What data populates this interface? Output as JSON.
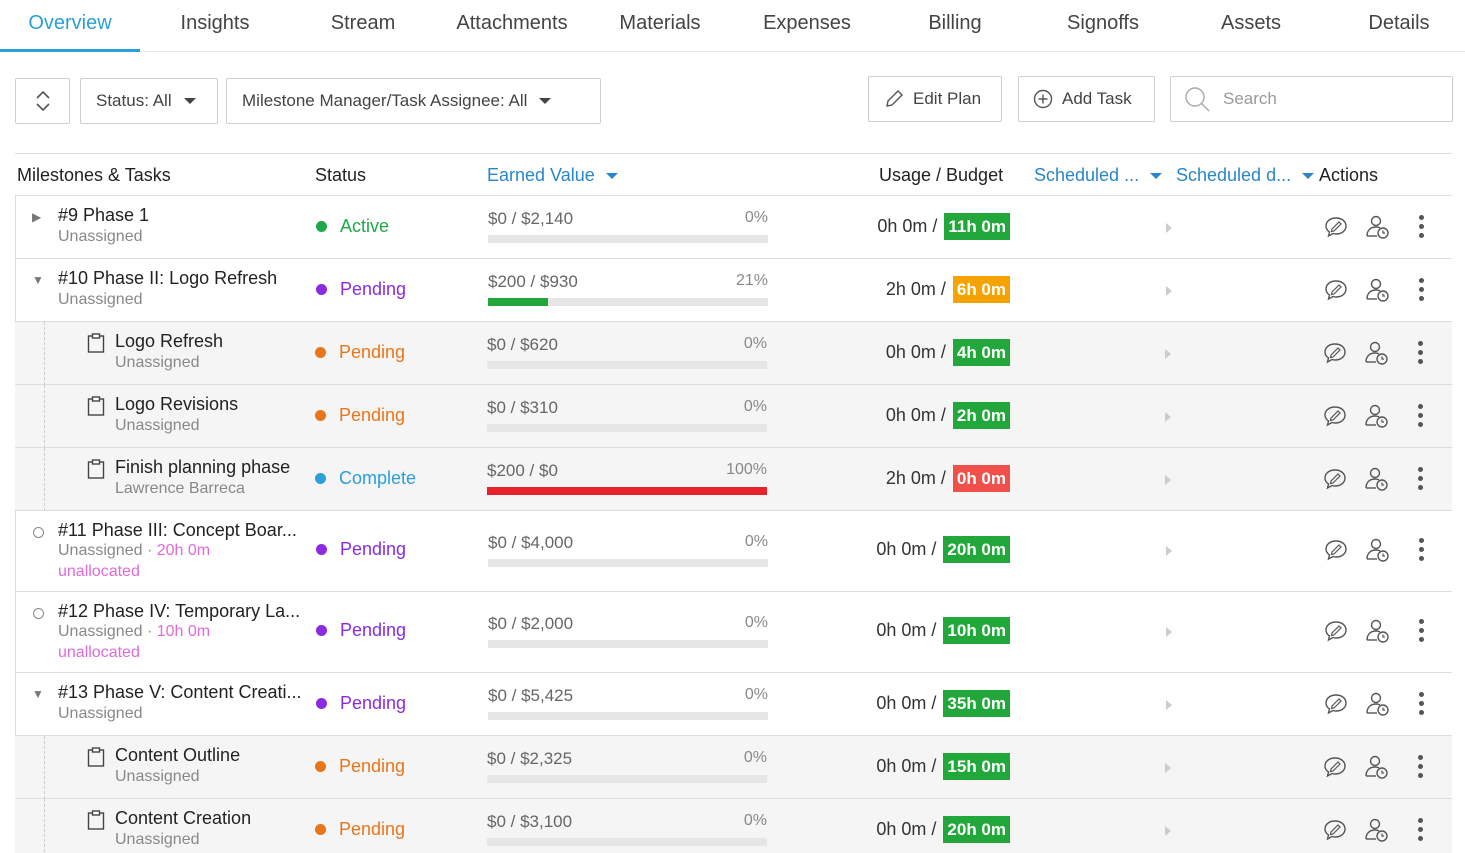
{
  "tabs": [
    "Overview",
    "Insights",
    "Stream",
    "Attachments",
    "Materials",
    "Expenses",
    "Billing",
    "Signoffs",
    "Assets",
    "Details"
  ],
  "toolbar": {
    "status_filter": "Status: All",
    "assignee_filter": "Milestone Manager/Task Assignee: All",
    "edit_plan": "Edit Plan",
    "add_task": "Add Task",
    "search_placeholder": "Search"
  },
  "table": {
    "headers": {
      "name": "Milestones & Tasks",
      "status": "Status",
      "earned_value": "Earned Value",
      "usage_budget": "Usage / Budget",
      "scheduled_start": "Scheduled ...",
      "scheduled_due": "Scheduled d...",
      "actions": "Actions"
    },
    "rows": [
      {
        "kind": "milestone",
        "toggle": "▶",
        "name": "#9 Phase 1",
        "assignee": "Unassigned",
        "status": "Active",
        "status_color": "#1fa84a",
        "ev": "$0 / $2,140",
        "pct": "0%",
        "fill": 0,
        "fill_color": "#22a83a",
        "usage": "0h 0m /",
        "budget": "11h 0m",
        "budget_color": "#22a83a"
      },
      {
        "kind": "milestone",
        "toggle": "▼",
        "name": "#10 Phase II: Logo Refresh",
        "assignee": "Unassigned",
        "status": "Pending",
        "status_color": "#8a2be2",
        "ev": "$200 / $930",
        "pct": "21%",
        "fill": 0.215,
        "fill_color": "#22a83a",
        "usage": "2h 0m /",
        "budget": "6h 0m",
        "budget_color": "#f5a300"
      },
      {
        "kind": "task",
        "name": "Logo Refresh",
        "assignee": "Unassigned",
        "status": "Pending",
        "status_color": "#e8751a",
        "ev": "$0 / $620",
        "pct": "0%",
        "fill": 0,
        "fill_color": "#22a83a",
        "usage": "0h 0m /",
        "budget": "4h 0m",
        "budget_color": "#22a83a"
      },
      {
        "kind": "task",
        "name": "Logo Revisions",
        "assignee": "Unassigned",
        "status": "Pending",
        "status_color": "#e8751a",
        "ev": "$0 / $310",
        "pct": "0%",
        "fill": 0,
        "fill_color": "#22a83a",
        "usage": "0h 0m /",
        "budget": "2h 0m",
        "budget_color": "#22a83a"
      },
      {
        "kind": "task",
        "name": "Finish planning phase",
        "assignee": "Lawrence Barreca",
        "status": "Complete",
        "status_color": "#2a9fd8",
        "ev": "$200 / $0",
        "pct": "100%",
        "fill": 1,
        "fill_color": "#e8222a",
        "usage": "2h 0m /",
        "budget": "0h 0m",
        "budget_color": "#f0504a"
      },
      {
        "kind": "milestone",
        "toggle": "circle",
        "name": "#11 Phase III: Concept Boar...",
        "assignee": "Unassigned",
        "hours": "20h 0m",
        "unallocated": "unallocated",
        "status": "Pending",
        "status_color": "#8a2be2",
        "ev": "$0 / $4,000",
        "pct": "0%",
        "fill": 0,
        "fill_color": "#22a83a",
        "usage": "0h 0m /",
        "budget": "20h 0m",
        "budget_color": "#22a83a"
      },
      {
        "kind": "milestone",
        "toggle": "circle",
        "name": "#12 Phase IV: Temporary La...",
        "assignee": "Unassigned",
        "hours": "10h 0m",
        "unallocated": "unallocated",
        "status": "Pending",
        "status_color": "#8a2be2",
        "ev": "$0 / $2,000",
        "pct": "0%",
        "fill": 0,
        "fill_color": "#22a83a",
        "usage": "0h 0m /",
        "budget": "10h 0m",
        "budget_color": "#22a83a"
      },
      {
        "kind": "milestone",
        "toggle": "▼",
        "name": "#13 Phase V: Content Creati...",
        "assignee": "Unassigned",
        "status": "Pending",
        "status_color": "#8a2be2",
        "ev": "$0 / $5,425",
        "pct": "0%",
        "fill": 0,
        "fill_color": "#22a83a",
        "usage": "0h 0m /",
        "budget": "35h 0m",
        "budget_color": "#22a83a"
      },
      {
        "kind": "task",
        "name": "Content Outline",
        "assignee": "Unassigned",
        "status": "Pending",
        "status_color": "#e8751a",
        "ev": "$0 / $2,325",
        "pct": "0%",
        "fill": 0,
        "fill_color": "#22a83a",
        "usage": "0h 0m /",
        "budget": "15h 0m",
        "budget_color": "#22a83a"
      },
      {
        "kind": "task",
        "name": "Content Creation",
        "assignee": "Unassigned",
        "status": "Pending",
        "status_color": "#e8751a",
        "ev": "$0 / $3,100",
        "pct": "0%",
        "fill": 0,
        "fill_color": "#22a83a",
        "usage": "0h 0m /",
        "budget": "20h 0m",
        "budget_color": "#22a83a"
      }
    ]
  },
  "icons": [
    "sort-icon",
    "caret-down-icon",
    "pencil-icon",
    "plus-circle-icon",
    "search-icon",
    "expand-arrow-icon",
    "clipboard-icon",
    "comment-icon",
    "assign-user-icon",
    "more-vert-icon"
  ]
}
